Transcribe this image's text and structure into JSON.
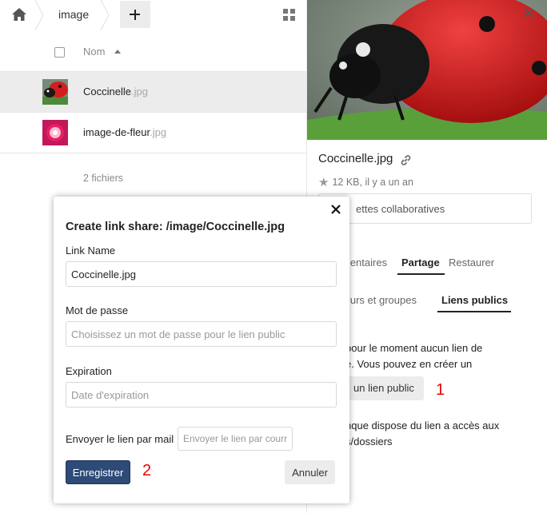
{
  "breadcrumb": {
    "folder": "image"
  },
  "file_list": {
    "column_name": "Nom",
    "files": [
      {
        "name": "Coccinelle",
        "ext": ".jpg",
        "thumbnail": "ladybug-thumbnail"
      },
      {
        "name": "image-de-fleur",
        "ext": ".jpg",
        "thumbnail": "flower-thumbnail"
      }
    ],
    "count_label": "2 fichiers"
  },
  "sidebar": {
    "filename": "Coccinelle.jpg",
    "meta": "12 KB, il y a un an",
    "tags_button": "ettes collaboratives",
    "tabs": [
      "mentaires",
      "Partage",
      "Restaurer"
    ],
    "subtabs": [
      "teurs et groupes",
      "Liens publics"
    ],
    "info_line1": "pour le moment aucun lien de",
    "info_line2": "e. Vous pouvez en créer un",
    "create_link": "un lien public",
    "access_line1": "nque dispose du lien a accès aux",
    "access_line2": "s/dossiers"
  },
  "modal": {
    "title": "Create link share: /image/Coccinelle.jpg",
    "link_name_label": "Link Name",
    "link_name_value": "Coccinelle.jpg",
    "password_label": "Mot de passe",
    "password_placeholder": "Choisissez un mot de passe pour le lien public",
    "expiration_label": "Expiration",
    "expiration_placeholder": "Date d'expiration",
    "mail_label": "Envoyer le lien par mail",
    "mail_placeholder": "Envoyer le lien par courriel",
    "save_label": "Enregistrer",
    "cancel_label": "Annuler"
  },
  "annotations": {
    "one": "1",
    "two": "2",
    "color": "#e00000"
  },
  "colors": {
    "primary_button": "#2e4a76",
    "row_selected": "#ececec"
  }
}
